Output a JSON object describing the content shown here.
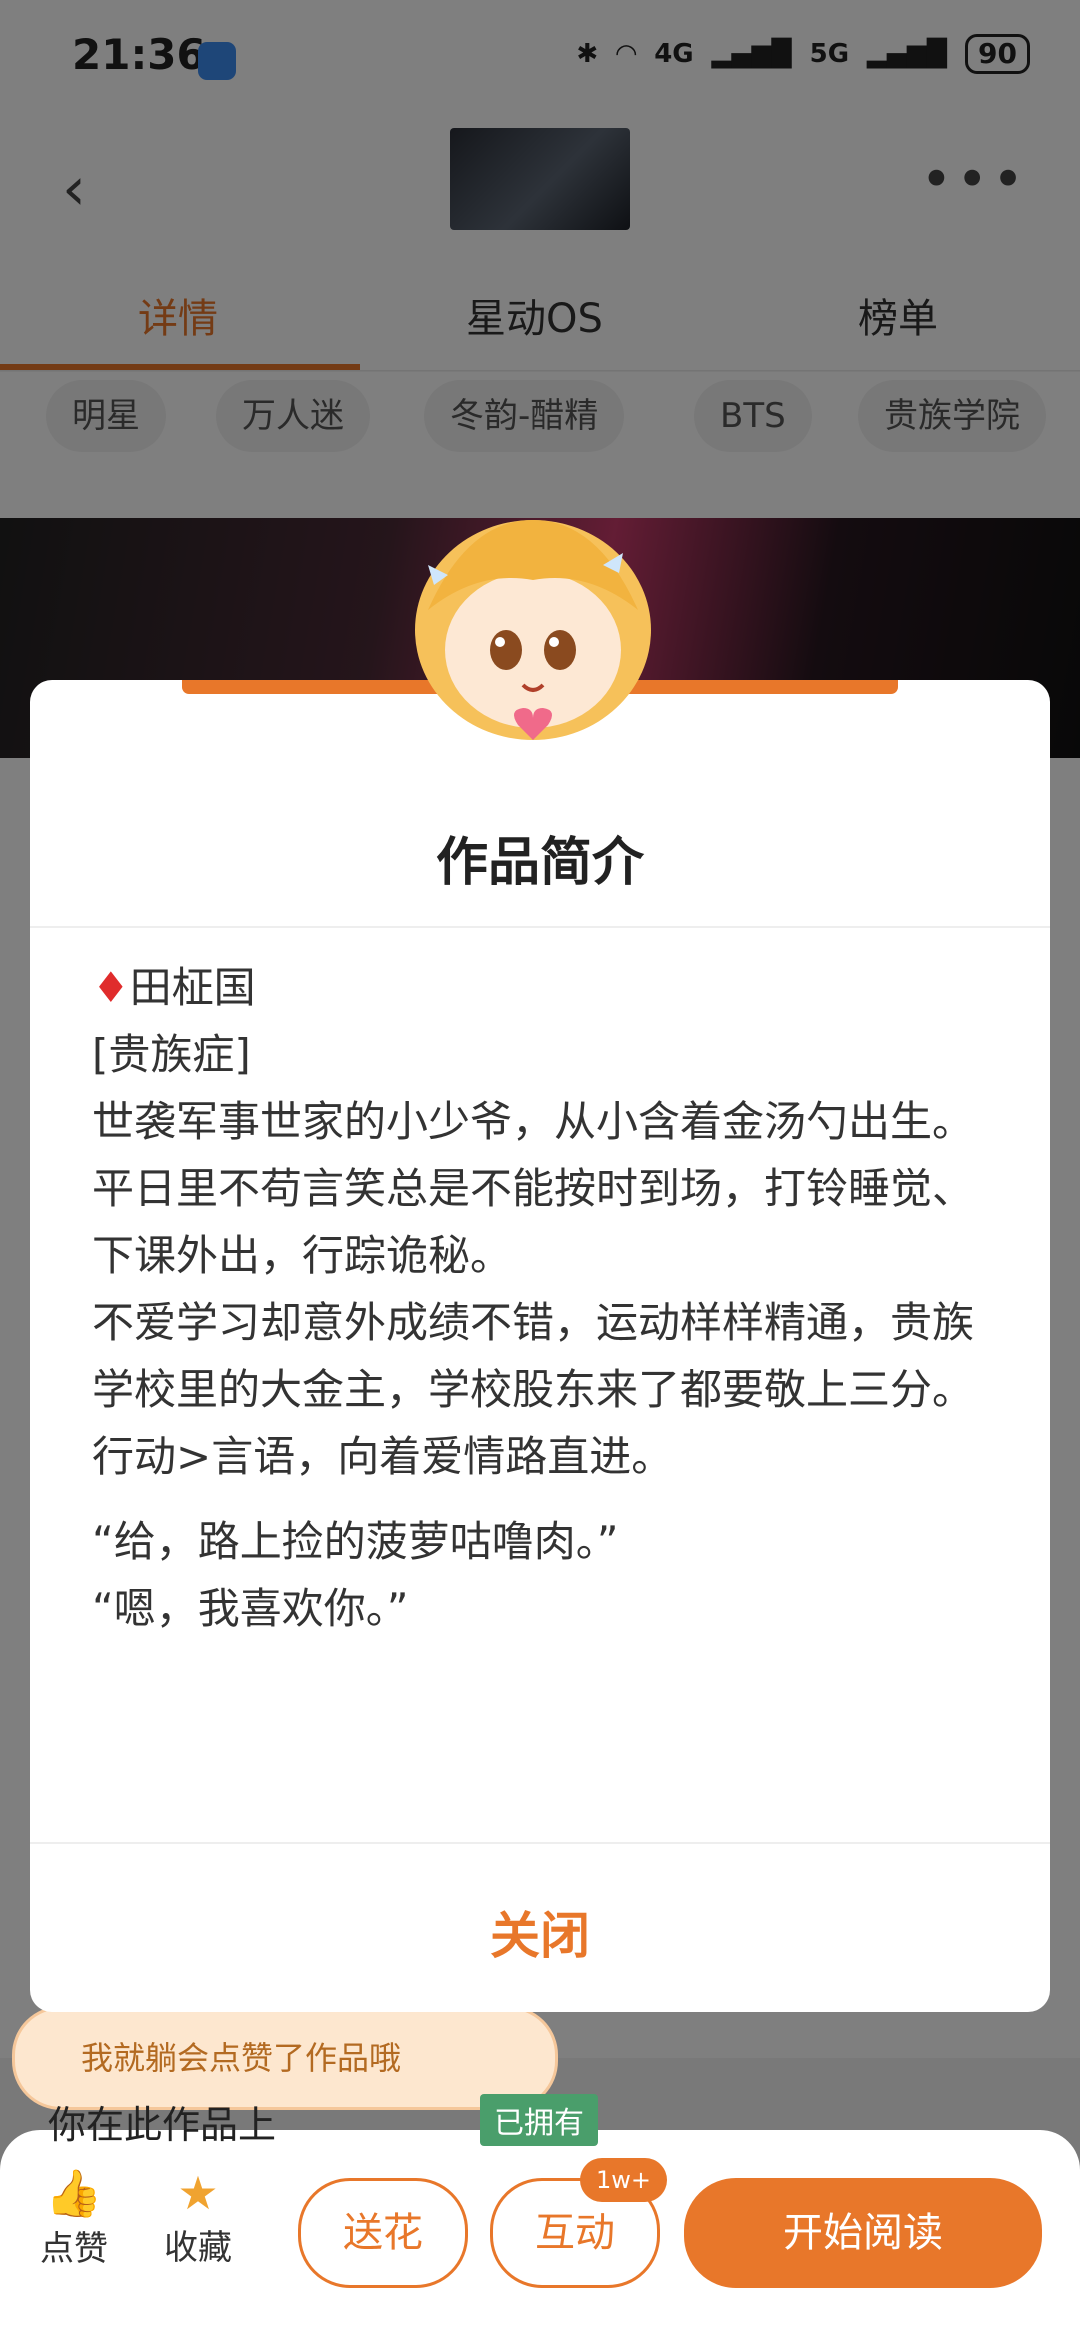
{
  "status_bar": {
    "time": "21:36",
    "network": "4G",
    "network2": "5G",
    "battery": "90"
  },
  "tabs": [
    "详情",
    "星动OS",
    "榜单"
  ],
  "tags": [
    "明星",
    "万人迷",
    "冬韵-醋精",
    "BTS",
    "贵族学院"
  ],
  "modal": {
    "title": "作品简介",
    "lines": [
      "田柾国",
      "[贵族症]",
      "世袭军事世家的小少爷，从小含着金汤勺出生。",
      "平日里不苟言笑总是不能按时到场，打铃睡觉、下课外出，行踪诡秘。",
      "不爱学习却意外成绩不错，运动样样精通，贵族学校里的大金主，学校股东来了都要敬上三分。",
      "行动>言语，向着爱情路直进。",
      "",
      "“给，路上捡的菠萝咕噜肉。”",
      "“嗯，我喜欢你。”"
    ],
    "diamond": "♦",
    "close_label": "关闭"
  },
  "bottom": {
    "like_bubble": "我就躺会点赞了作品哦",
    "stats_text": "你在此作品上",
    "owned_label": "已拥有",
    "like_label": "点赞",
    "favorite_label": "收藏",
    "gift_label": "送花",
    "interact_label": "互动",
    "interact_badge": "1w+",
    "read_label": "开始阅读"
  },
  "colors": {
    "accent": "#e8772a",
    "diamond": "#e02c2c",
    "owned": "#4a9e6b"
  }
}
